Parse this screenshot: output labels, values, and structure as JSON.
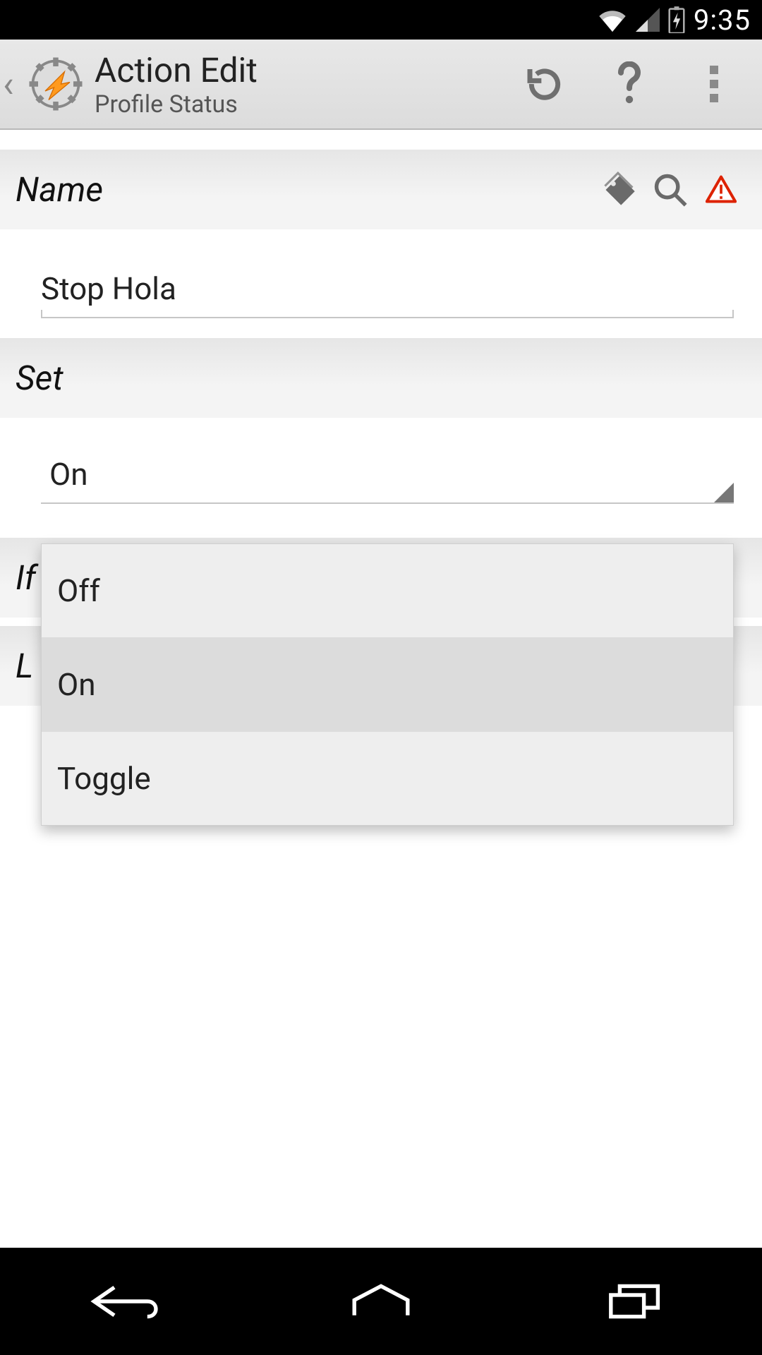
{
  "status_bar": {
    "time": "9:35"
  },
  "action_bar": {
    "title": "Action Edit",
    "subtitle": "Profile Status"
  },
  "sections": {
    "name": {
      "label": "Name",
      "value": "Stop Hola"
    },
    "set": {
      "label": "Set",
      "selected": "On",
      "options": [
        "Off",
        "On",
        "Toggle"
      ]
    },
    "if": {
      "label": "If"
    },
    "l_partial": {
      "label": "L"
    }
  }
}
